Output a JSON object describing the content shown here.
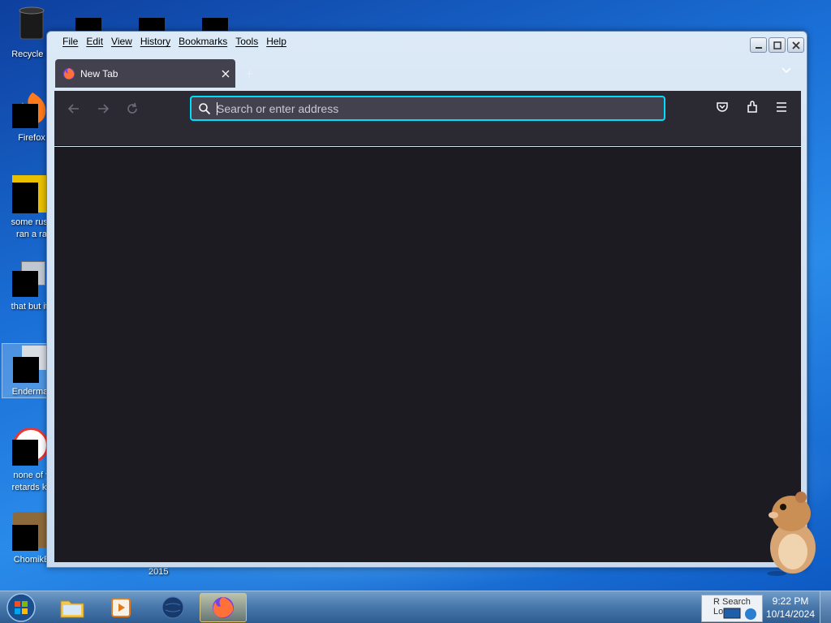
{
  "desktop": {
    "icons": [
      {
        "label": "Recycle B",
        "label2": ""
      },
      {
        "label": "Firefox",
        "label2": ""
      },
      {
        "label": "some russ",
        "label2": "ran a ra"
      },
      {
        "label": "that but its",
        "label2": ""
      },
      {
        "label": "Enderman",
        "label2": ""
      },
      {
        "label": "none of y",
        "label2": "retards kn"
      },
      {
        "label": "ChomikB",
        "label2": ""
      }
    ],
    "stray_label": "2015"
  },
  "window": {
    "menu": [
      "File",
      "Edit",
      "View",
      "History",
      "Bookmarks",
      "Tools",
      "Help"
    ],
    "tab_title": "New Tab",
    "new_tab_glyph": "+",
    "url_placeholder": "Search or enter address",
    "url_value": ""
  },
  "taskbar": {
    "notification_text": "R   Search Lo",
    "clock_time": "9:22 PM",
    "clock_date": "10/14/2024"
  },
  "colors": {
    "tab_bg": "#42414d",
    "toolbar_bg": "#2b2a33",
    "content_bg": "#1c1b22",
    "focus_ring": "#00ddff"
  },
  "icons": {
    "tab_favicon": "firefox-icon",
    "urlbar": "search-icon",
    "toolbar_right": [
      "pocket-icon",
      "extensions-icon",
      "hamburger-menu-icon"
    ]
  }
}
